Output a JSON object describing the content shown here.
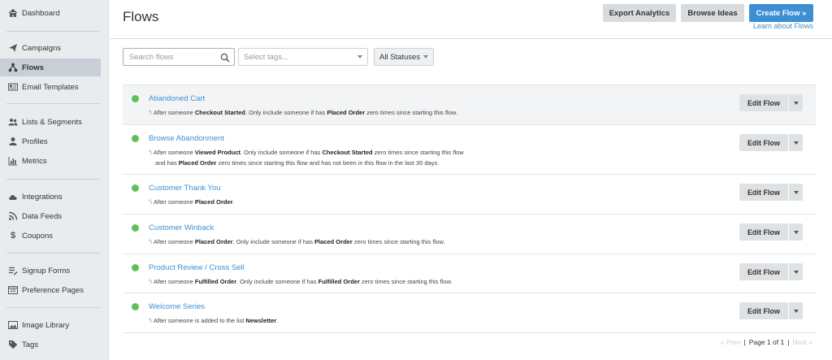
{
  "sidebar": {
    "items": [
      {
        "id": "dashboard",
        "label": "Dashboard",
        "icon": "home-icon"
      },
      {
        "id": "campaigns",
        "label": "Campaigns",
        "icon": "paper-plane-icon"
      },
      {
        "id": "flows",
        "label": "Flows",
        "icon": "flows-icon",
        "active": true
      },
      {
        "id": "email-templates",
        "label": "Email Templates",
        "icon": "template-icon"
      },
      {
        "id": "lists-segments",
        "label": "Lists & Segments",
        "icon": "users-icon"
      },
      {
        "id": "profiles",
        "label": "Profiles",
        "icon": "user-icon"
      },
      {
        "id": "metrics",
        "label": "Metrics",
        "icon": "bar-chart-icon"
      },
      {
        "id": "integrations",
        "label": "Integrations",
        "icon": "cloud-icon"
      },
      {
        "id": "data-feeds",
        "label": "Data Feeds",
        "icon": "rss-icon"
      },
      {
        "id": "coupons",
        "label": "Coupons",
        "icon": "dollar-icon"
      },
      {
        "id": "signup-forms",
        "label": "Signup Forms",
        "icon": "form-icon"
      },
      {
        "id": "preference-pages",
        "label": "Preference Pages",
        "icon": "preference-page-icon"
      },
      {
        "id": "image-library",
        "label": "Image Library",
        "icon": "image-icon"
      },
      {
        "id": "tags",
        "label": "Tags",
        "icon": "tag-icon"
      }
    ]
  },
  "header": {
    "title": "Flows",
    "export_label": "Export Analytics",
    "browse_label": "Browse Ideas",
    "create_label": "Create Flow »",
    "learn_label": "Learn about Flows"
  },
  "filters": {
    "search_placeholder": "Search flows",
    "tags_placeholder": "Select tags...",
    "status_value": "All Statuses"
  },
  "flows": [
    {
      "name": "Abandoned Cart",
      "status": "live",
      "line1": [
        [
          "After someone ",
          false
        ],
        [
          "Checkout Started",
          true
        ],
        [
          ". Only include someone if has ",
          false
        ],
        [
          "Placed Order",
          true
        ],
        [
          " zero times since starting this flow.",
          false
        ]
      ],
      "line2": []
    },
    {
      "name": "Browse Abandonment",
      "status": "live",
      "line1": [
        [
          "After someone ",
          false
        ],
        [
          "Viewed Product",
          true
        ],
        [
          ". Only include someone if has ",
          false
        ],
        [
          "Checkout Started",
          true
        ],
        [
          " zero times since starting this flow",
          false
        ]
      ],
      "line2": [
        [
          "and has ",
          false
        ],
        [
          "Placed Order",
          true
        ],
        [
          " zero times since starting this flow and has not been in this flow in the last 30 days.",
          false
        ]
      ]
    },
    {
      "name": "Customer Thank You",
      "status": "live",
      "line1": [
        [
          "After someone ",
          false
        ],
        [
          "Placed Order",
          true
        ],
        [
          ".",
          false
        ]
      ],
      "line2": []
    },
    {
      "name": "Customer Winback",
      "status": "live",
      "line1": [
        [
          "After someone ",
          false
        ],
        [
          "Placed Order",
          true
        ],
        [
          ". Only include someone if has ",
          false
        ],
        [
          "Placed Order",
          true
        ],
        [
          " zero times since starting this flow.",
          false
        ]
      ],
      "line2": []
    },
    {
      "name": "Product Review / Cross Sell",
      "status": "live",
      "line1": [
        [
          "After someone ",
          false
        ],
        [
          "Fulfilled Order",
          true
        ],
        [
          ". Only include someone if has ",
          false
        ],
        [
          "Fulfilled Order",
          true
        ],
        [
          " zero times since starting this flow.",
          false
        ]
      ],
      "line2": []
    },
    {
      "name": "Welcome Series",
      "status": "live",
      "line1": [
        [
          "After someone is added to the list ",
          false
        ],
        [
          "Newsletter",
          true
        ],
        [
          ".",
          false
        ]
      ],
      "line2": []
    }
  ],
  "edit_label": "Edit Flow",
  "pagination": {
    "prev": "« Prev",
    "page_text": "Page 1 of 1",
    "next": "Next »"
  },
  "colors": {
    "accent": "#3d8fd3",
    "status_live": "#5cc15c",
    "sidebar_bg": "#e9ecef"
  }
}
